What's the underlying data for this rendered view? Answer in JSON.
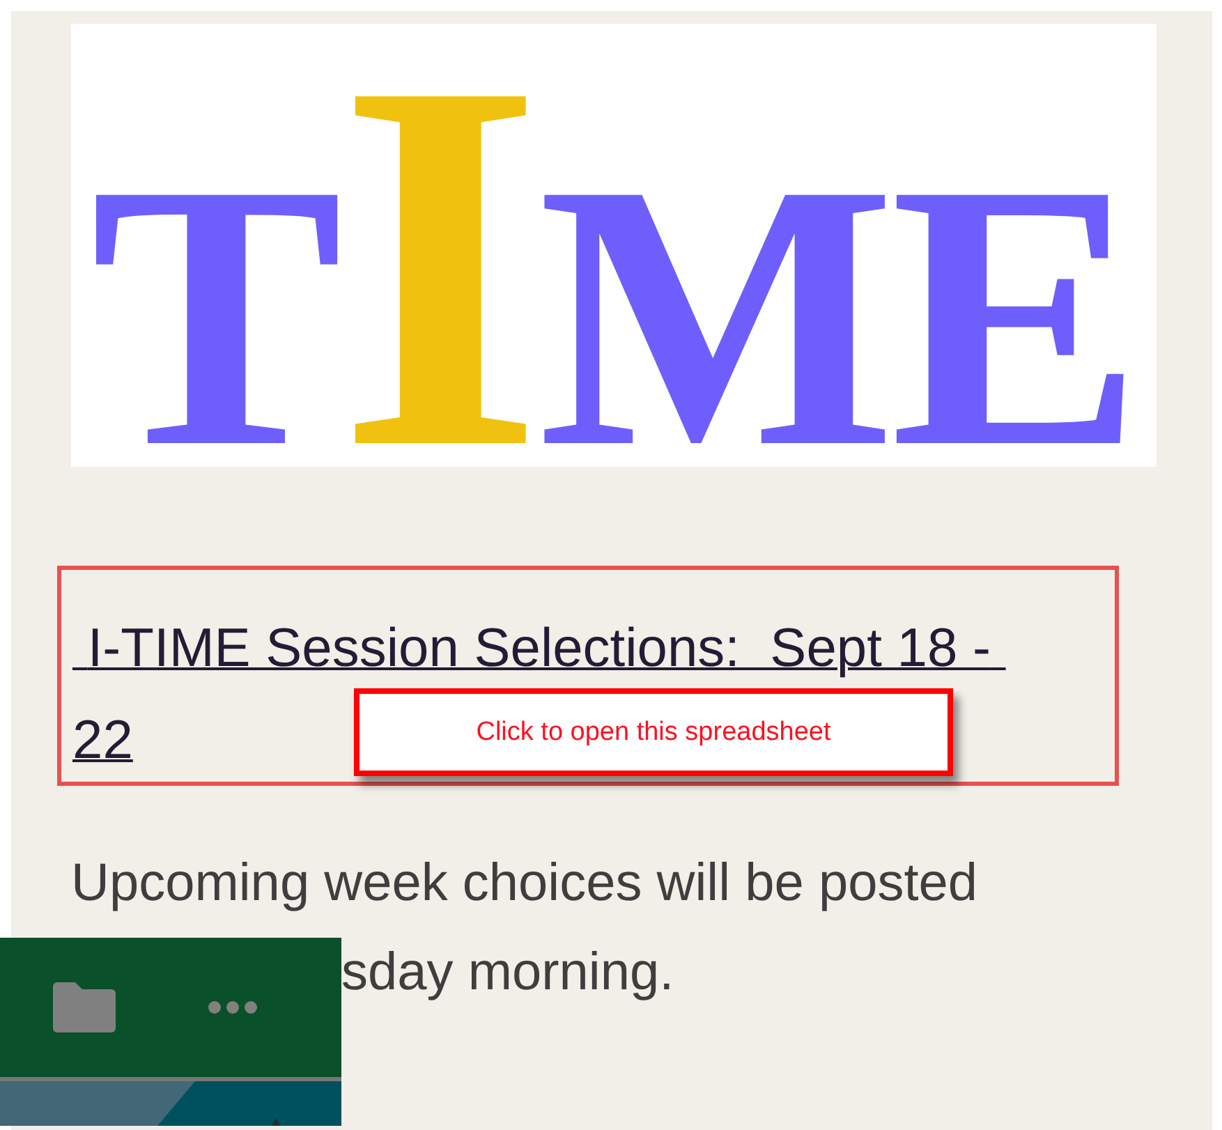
{
  "logo": {
    "letters": [
      {
        "text": "T",
        "color": "#6e5ffc",
        "kind": "regular"
      },
      {
        "text": "I",
        "color": "#f0c20f",
        "kind": "tall"
      },
      {
        "text": "M",
        "color": "#6e5ffc",
        "kind": "regular"
      },
      {
        "text": "E",
        "color": "#6e5ffc",
        "kind": "regular"
      }
    ]
  },
  "link": {
    "text": " I-TIME Session Selections:  Sept 18 - 22"
  },
  "tooltip": {
    "text": "Click to open this spreadsheet"
  },
  "paragraph": {
    "lines": [
      "Upcoming week choices will be posted",
      "sday morning."
    ]
  }
}
